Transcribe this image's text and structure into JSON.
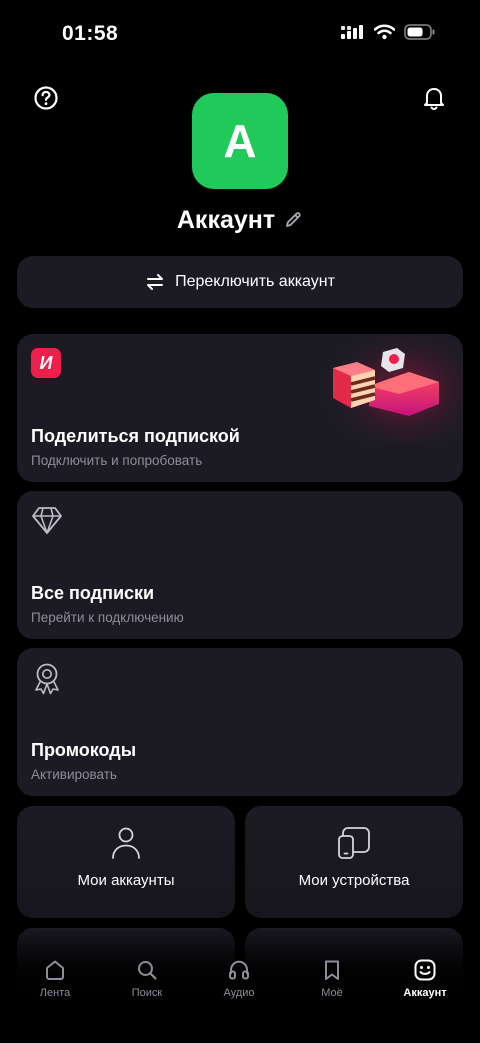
{
  "status": {
    "time": "01:58"
  },
  "account": {
    "avatar_letter": "A",
    "title": "Аккаунт"
  },
  "switch_account": {
    "label": "Переключить аккаунт"
  },
  "cards": [
    {
      "title": "Поделиться подпиской",
      "subtitle": "Подключить и попробовать",
      "badge_letter": "И",
      "icon": "brand-logo-icon"
    },
    {
      "title": "Все подписки",
      "subtitle": "Перейти к подключению",
      "icon": "diamond-icon"
    },
    {
      "title": "Промокоды",
      "subtitle": "Активировать",
      "icon": "award-badge-icon"
    }
  ],
  "tiles": [
    {
      "label": "Мои аккаунты",
      "icon": "user-icon"
    },
    {
      "label": "Мои устройства",
      "icon": "devices-icon"
    }
  ],
  "tabs": [
    {
      "label": "Лента",
      "icon": "home-icon"
    },
    {
      "label": "Поиск",
      "icon": "search-icon"
    },
    {
      "label": "Аудио",
      "icon": "headphones-icon"
    },
    {
      "label": "Моё",
      "icon": "bookmark-icon"
    },
    {
      "label": "Аккаунт",
      "icon": "account-face-icon",
      "active": true
    }
  ],
  "colors": {
    "background": "#000000",
    "card": "#1c1b24",
    "avatar": "#20c95a",
    "brand": "#ee1f4b",
    "muted_text": "#8e8d99"
  }
}
